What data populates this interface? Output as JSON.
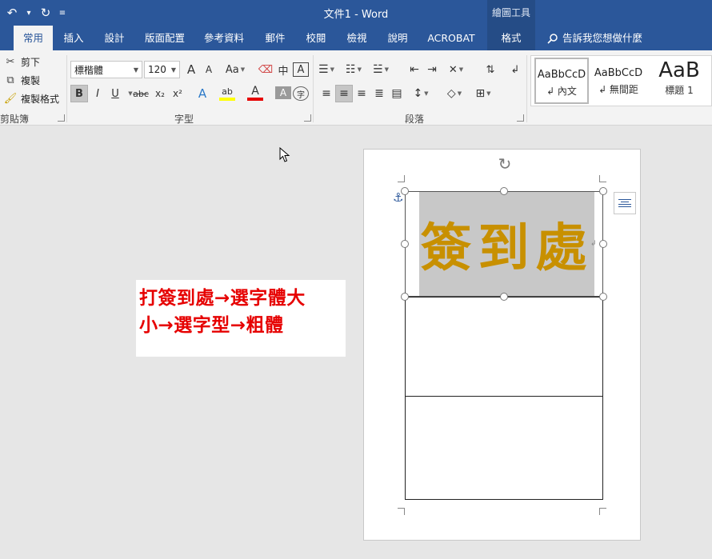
{
  "window": {
    "title": "文件1  -  Word",
    "context_title": "繪圖工具"
  },
  "qat": {
    "undo_icon": "undo-icon",
    "redo_icon": "redo-icon",
    "customize_icon": "customize-qat-icon"
  },
  "tabs": [
    {
      "label": "常用",
      "active": true
    },
    {
      "label": "插入"
    },
    {
      "label": "設計"
    },
    {
      "label": "版面配置"
    },
    {
      "label": "參考資料"
    },
    {
      "label": "郵件"
    },
    {
      "label": "校閱"
    },
    {
      "label": "檢視"
    },
    {
      "label": "說明"
    },
    {
      "label": "ACROBAT"
    },
    {
      "label": "格式",
      "contextual": true
    }
  ],
  "tell_me": "告訴我您想做什麼",
  "clipboard": {
    "cut": "剪下",
    "copy": "複製",
    "format_painter": "複製格式",
    "group_label": "剪貼簿"
  },
  "font": {
    "name": "標楷體",
    "size": "120",
    "change_case": "Aa",
    "group_label": "字型",
    "grow_icon": "A",
    "shrink_icon": "A",
    "phonetic": "中",
    "border_char": "A",
    "bold": "B",
    "italic": "I",
    "underline": "U",
    "strike": "abc",
    "subscript": "x₂",
    "superscript": "x²",
    "text_effect": "A",
    "highlight": "ab",
    "font_color": "A",
    "char_shading": "A",
    "enclose": "字"
  },
  "paragraph": {
    "group_label": "段落"
  },
  "styles": [
    {
      "sample": "AaBbCcD",
      "name": "↲ 內文"
    },
    {
      "sample": "AaBbCcD",
      "name": "↲ 無間距"
    },
    {
      "sample": "AaB",
      "name": "標題 1"
    }
  ],
  "note": {
    "line1": "打簽到處→選字體大",
    "line2": "小→選字型→粗體"
  },
  "document": {
    "textbox_text": "簽到處",
    "para_mark": "↲"
  },
  "colors": {
    "word_blue": "#2b579a",
    "note_red": "#e60000",
    "gold_text": "#c89000",
    "text_highlight": "#c8c8c8"
  }
}
